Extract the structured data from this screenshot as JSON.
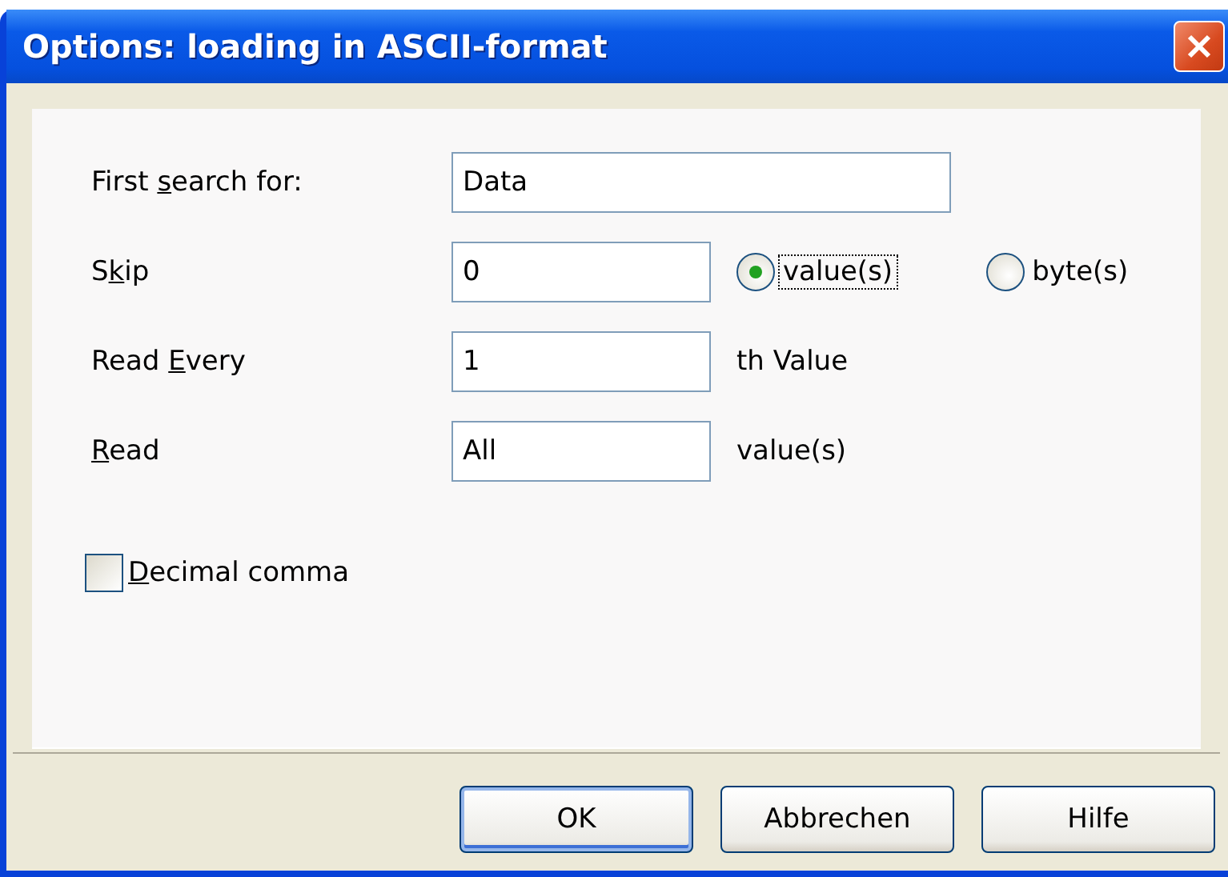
{
  "window": {
    "title": "Options: loading in ASCII-format",
    "close_icon": true
  },
  "fields": [
    {
      "label_before": "First ",
      "access_key": "s",
      "label_after": "earch for:",
      "value": "Data",
      "wide": true
    },
    {
      "label_before": "S",
      "access_key": "k",
      "label_after": "ip",
      "value": "0",
      "wide": false,
      "options": [
        {
          "label": "value(s)",
          "selected": true,
          "focused": true
        },
        {
          "label": "byte(s)",
          "selected": false,
          "focused": false
        }
      ]
    },
    {
      "label_before": "Read ",
      "access_key": "E",
      "label_after": "very",
      "value": "1",
      "wide": false,
      "suffix": "th Value"
    },
    {
      "access_key": "R",
      "label_after": "ead",
      "value": "All",
      "wide": false,
      "suffix": "value(s)"
    }
  ],
  "checkbox": {
    "access_key": "D",
    "label_after": "ecimal comma",
    "checked": false
  },
  "buttons": [
    {
      "label": "OK",
      "default": true
    },
    {
      "label": "Abbrechen",
      "default": false
    },
    {
      "label": "Hilfe",
      "default": false
    }
  ]
}
